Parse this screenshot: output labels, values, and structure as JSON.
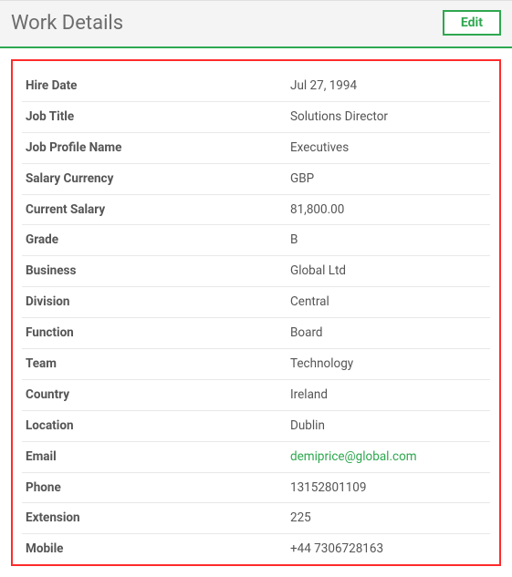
{
  "header": {
    "title": "Work Details",
    "edit_label": "Edit"
  },
  "fields": [
    {
      "label": "Hire Date",
      "value": "Jul 27, 1994",
      "link": false
    },
    {
      "label": "Job Title",
      "value": "Solutions Director",
      "link": false
    },
    {
      "label": "Job Profile Name",
      "value": "Executives",
      "link": false
    },
    {
      "label": "Salary Currency",
      "value": "GBP",
      "link": false
    },
    {
      "label": "Current Salary",
      "value": "81,800.00",
      "link": false
    },
    {
      "label": "Grade",
      "value": "B",
      "link": false
    },
    {
      "label": "Business",
      "value": "Global Ltd",
      "link": false
    },
    {
      "label": "Division",
      "value": "Central",
      "link": false
    },
    {
      "label": "Function",
      "value": "Board",
      "link": false
    },
    {
      "label": "Team",
      "value": "Technology",
      "link": false
    },
    {
      "label": "Country",
      "value": "Ireland",
      "link": false
    },
    {
      "label": "Location",
      "value": "Dublin",
      "link": false
    },
    {
      "label": "Email",
      "value": "demiprice@global.com",
      "link": true
    },
    {
      "label": "Phone",
      "value": "13152801109",
      "link": false
    },
    {
      "label": "Extension",
      "value": "225",
      "link": false
    },
    {
      "label": "Mobile",
      "value": "+44 7306728163",
      "link": false
    }
  ]
}
